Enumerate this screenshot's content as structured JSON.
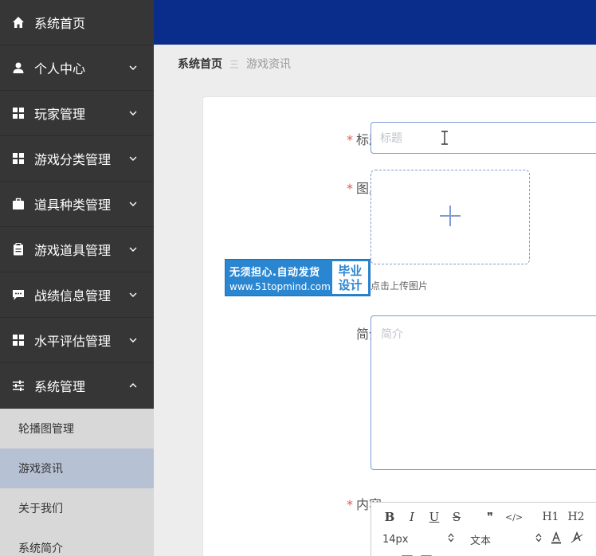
{
  "sidebar": {
    "items": [
      {
        "label": "系统首页",
        "icon": "home-icon"
      },
      {
        "label": "个人中心",
        "icon": "user-icon"
      },
      {
        "label": "玩家管理",
        "icon": "grid-icon"
      },
      {
        "label": "游戏分类管理",
        "icon": "grid-icon"
      },
      {
        "label": "道具种类管理",
        "icon": "briefcase-icon"
      },
      {
        "label": "游戏道具管理",
        "icon": "clipboard-icon"
      },
      {
        "label": "战绩信息管理",
        "icon": "chat-icon"
      },
      {
        "label": "水平评估管理",
        "icon": "grid-icon"
      },
      {
        "label": "系统管理",
        "icon": "sliders-icon"
      }
    ],
    "submenu": [
      {
        "label": "轮播图管理"
      },
      {
        "label": "游戏资讯"
      },
      {
        "label": "关于我们"
      },
      {
        "label": "系统简介"
      }
    ]
  },
  "breadcrumb": {
    "home": "系统首页",
    "current": "游戏资讯"
  },
  "form": {
    "title_label": "标题",
    "title_placeholder": "标题",
    "image_label": "图片",
    "upload_tip": "点击上传图片",
    "intro_label": "简介",
    "intro_placeholder": "简介",
    "content_label": "内容",
    "required_mark": "*"
  },
  "editor": {
    "buttons": [
      "B",
      "I",
      "U",
      "S",
      "❞",
      "</>",
      "H1",
      "H2"
    ],
    "font_size": "14px",
    "format": "文本"
  },
  "watermark": {
    "line1": "无须担心.自动发货",
    "line2": "www.51topmind.com",
    "side1": "毕业",
    "side2": "设计"
  },
  "colors": {
    "sidebar_bg": "#363636",
    "header_bg": "#0a2c8a",
    "submenu_bg": "#d8d8d8",
    "submenu_active": "#b7c1d4",
    "accent": "#7e9bd4",
    "required": "#e35a4a"
  }
}
